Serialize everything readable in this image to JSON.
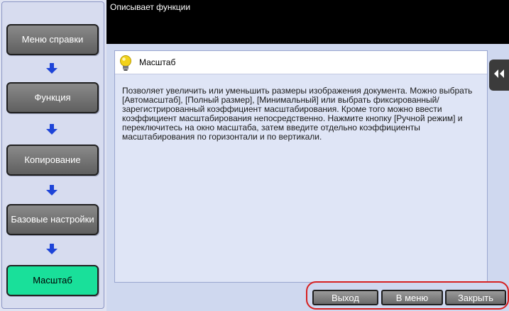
{
  "header": {
    "title": "Описывает функции"
  },
  "nav": {
    "items": [
      {
        "label": "Меню справки"
      },
      {
        "label": "Функция"
      },
      {
        "label": "Копирование"
      },
      {
        "label": "Базовые настройки"
      },
      {
        "label": "Масштаб",
        "active": true
      }
    ]
  },
  "content": {
    "title": "Масштаб",
    "description": "Позволяет увеличить или уменьшить размеры изображения документа. Можно выбрать [Автомасштаб], [Полный размер], [Минимальный] или выбрать фиксированный/зарегистрированный коэффициент масштабирования. Кроме того можно ввести коэффициент масштабирования непосредственно. Нажмите кнопку [Ручной режим] и переключитесь на окно масштаба, затем введите отдельно коэффициенты масштабирования по горизонтали и по вертикали."
  },
  "footer": {
    "exit_label": "Выход",
    "menu_label": "В меню",
    "close_label": "Закрыть"
  },
  "icons": {
    "nav_arrow": "arrow-down-icon",
    "content": "lightbulb-icon",
    "collapse": "double-chevron-left-icon"
  },
  "colors": {
    "active_nav": "#19e09a",
    "arrow": "#1e44d8",
    "highlight_border": "#d62020"
  }
}
